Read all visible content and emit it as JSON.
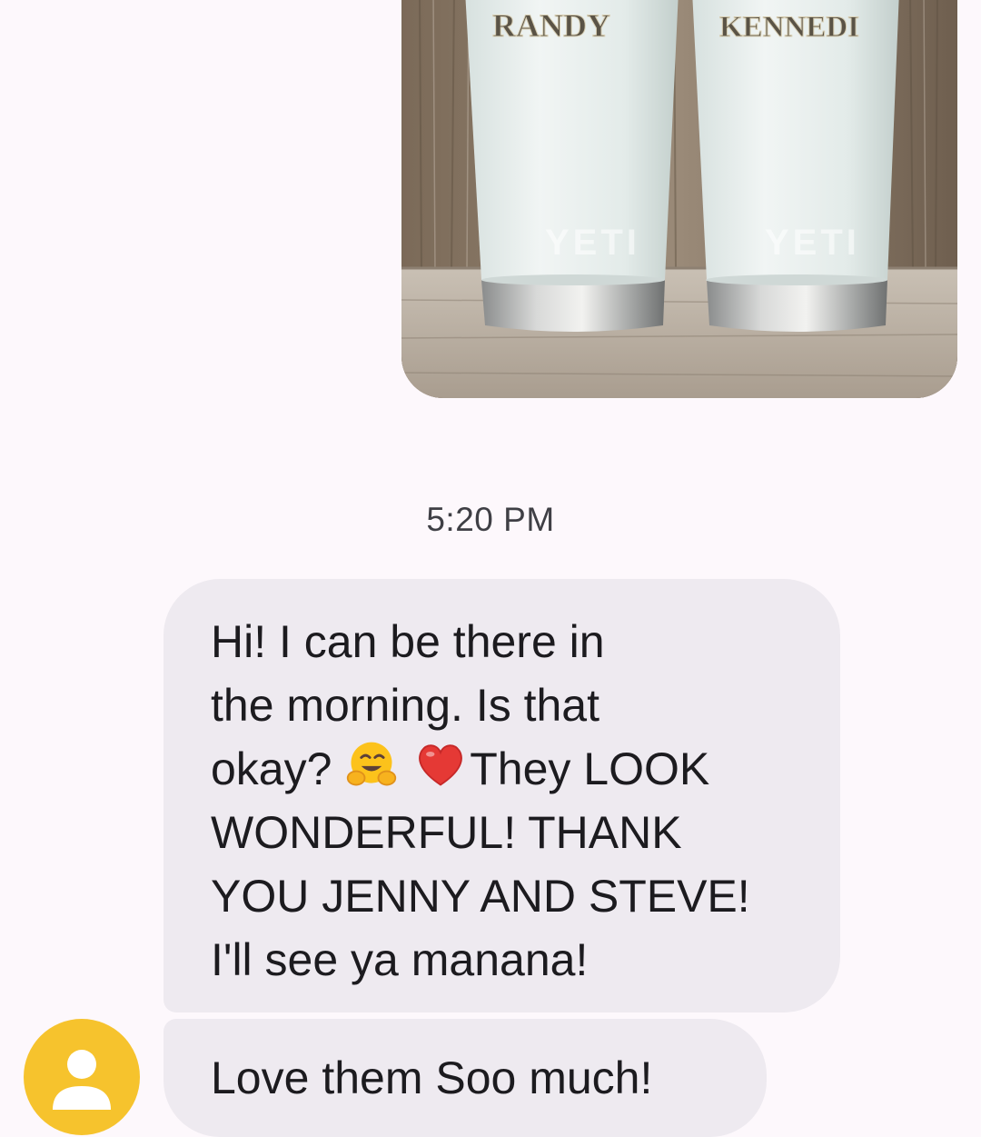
{
  "conversation": {
    "sent_photo": {
      "tumbler_names": [
        "RANDY",
        "KENNEDI"
      ],
      "brand_mark": "YETI",
      "icon": "photo-attachment"
    },
    "timestamp": "5:20 PM",
    "incoming_messages": [
      {
        "lines": [
          "Hi! I can be there in",
          "the morning. Is that",
          "okay? ",
          "They LOOK",
          "WONDERFUL! THANK",
          "YOU JENNY AND STEVE!",
          "I'll see ya manana!"
        ],
        "emojis": [
          "hugging-face-emoji",
          "red-heart-emoji"
        ]
      },
      {
        "text": "Love them Soo much!"
      }
    ],
    "contact_avatar": {
      "icon": "person-icon",
      "color": "#f6c32d"
    }
  },
  "colors": {
    "background": "#fdf8fc",
    "incoming_bubble": "#eeeaf0",
    "timestamp_text": "#3f3f45"
  }
}
